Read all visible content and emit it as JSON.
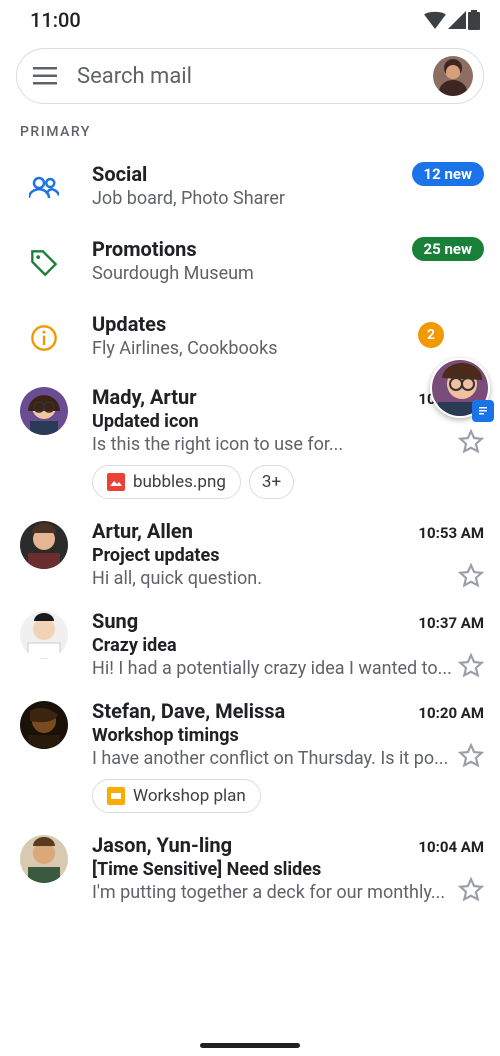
{
  "status": {
    "time": "11:00"
  },
  "search": {
    "placeholder": "Search mail"
  },
  "section_label": "PRIMARY",
  "sections": {
    "social": {
      "title": "Social",
      "summary": "Job board, Photo Sharer",
      "badge": "12 new"
    },
    "promotions": {
      "title": "Promotions",
      "summary": "Sourdough Museum",
      "badge": "25 new"
    },
    "updates": {
      "title": "Updates",
      "summary": "Fly Airlines, Cookbooks",
      "badge": "2"
    }
  },
  "emails": [
    {
      "senders": "Mady, Artur",
      "subject": "Updated icon",
      "snippet": "Is this the right icon to use for...",
      "time": "10:55 AM",
      "attachments": [
        {
          "kind": "image",
          "label": "bubbles.png"
        }
      ],
      "extra_chip": "3+"
    },
    {
      "senders": "Artur, Allen",
      "subject": "Project updates",
      "snippet": "Hi all, quick question.",
      "time": "10:53 AM"
    },
    {
      "senders": "Sung",
      "subject": "Crazy idea",
      "snippet": "Hi! I had a potentially crazy idea I wanted to...",
      "time": "10:37 AM"
    },
    {
      "senders": "Stefan, Dave, Melissa",
      "subject": "Workshop timings",
      "snippet": "I have another conflict on Thursday. Is it po...",
      "time": "10:20 AM",
      "attachments": [
        {
          "kind": "slides",
          "label": "Workshop plan"
        }
      ]
    },
    {
      "senders": "Jason, Yun-ling",
      "subject": "[Time Sensitive] Need slides",
      "snippet": "I'm putting together a deck for our monthly...",
      "time": "10:04 AM"
    }
  ]
}
